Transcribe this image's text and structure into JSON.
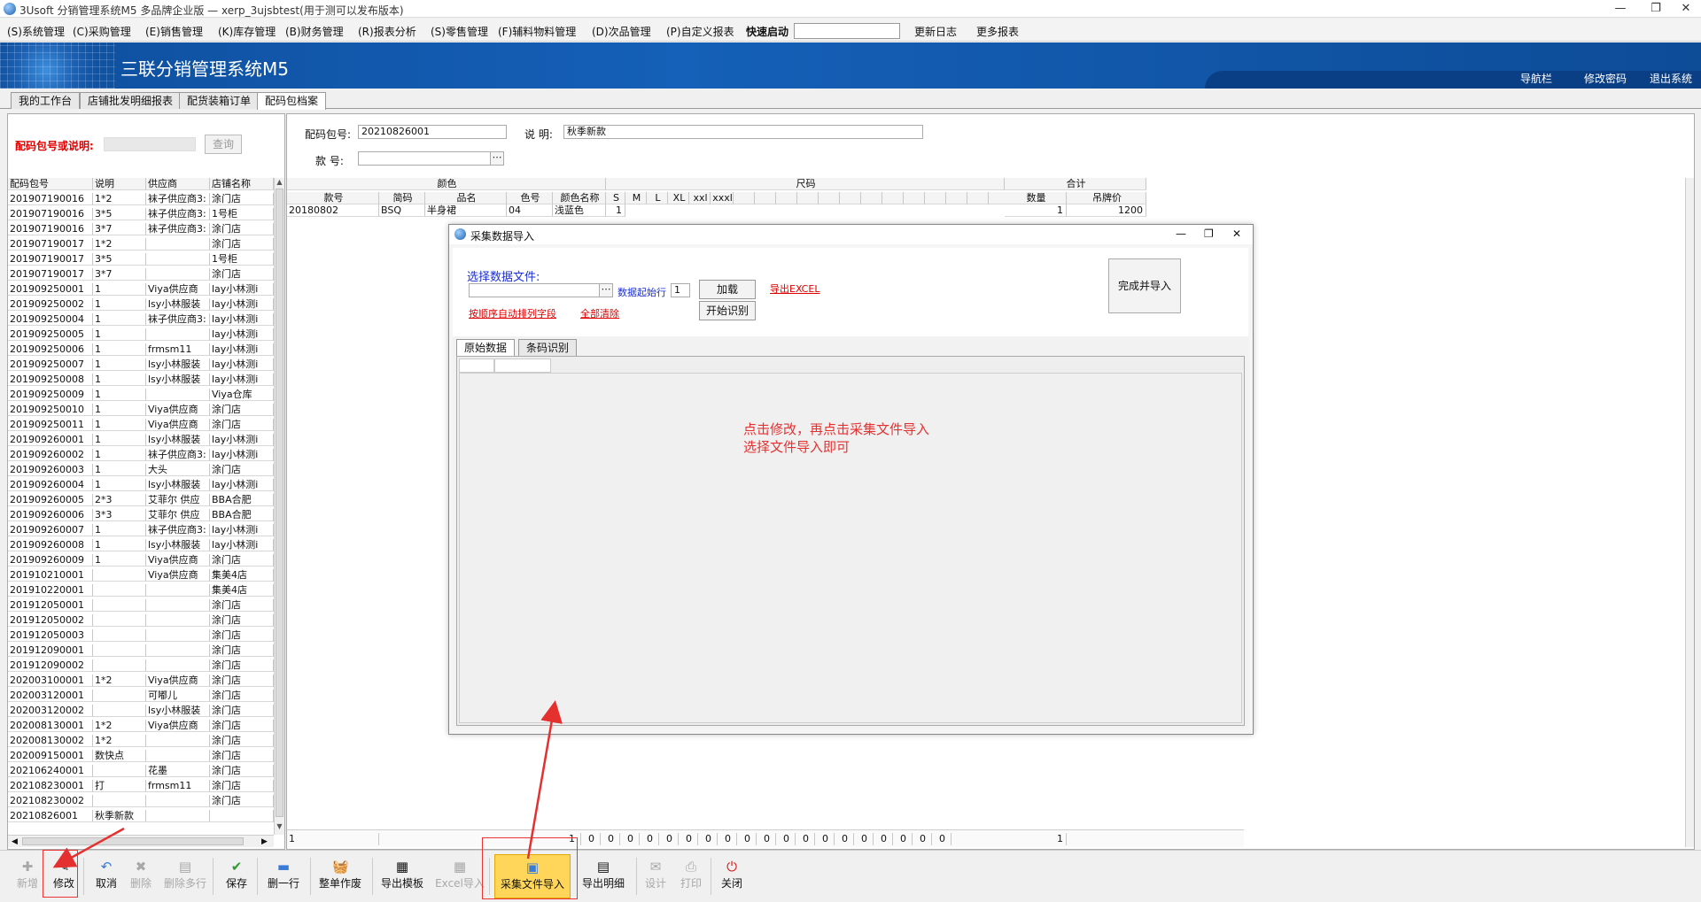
{
  "window": {
    "title": "3Usoft 分销管理系统M5 多品牌企业版 — xerp_3ujsbtest(用于测可以发布版本)"
  },
  "menu": {
    "items": [
      "(S)系统管理",
      "(C)采购管理",
      "(E)销售管理",
      "(K)库存管理",
      "(B)财务管理",
      "(R)报表分析",
      "(S)零售管理",
      "(F)辅料物料管理",
      "(D)次品管理",
      "(P)自定义报表"
    ],
    "quick_launch_label": "快速启动",
    "changelog": "更新日志",
    "more_reports": "更多报表"
  },
  "banner": {
    "system_name": "三联分销管理系统M5",
    "links": [
      "导航栏",
      "修改密码",
      "退出系统"
    ]
  },
  "tabs": [
    "我的工作台",
    "店铺批发明细报表",
    "配货装箱订单",
    "配码包档案"
  ],
  "left": {
    "search_label": "配码包号或说明:",
    "query_button": "查询",
    "columns": [
      "配码包号",
      "说明",
      "供应商",
      "店铺名称"
    ],
    "rows": [
      [
        "201907190016",
        "1*2",
        "袜子供应商3:",
        "涂门店"
      ],
      [
        "201907190016",
        "3*5",
        "袜子供应商3:",
        "1号柜"
      ],
      [
        "201907190016",
        "3*7",
        "袜子供应商3:",
        "涂门店"
      ],
      [
        "201907190017",
        "1*2",
        "",
        "涂门店"
      ],
      [
        "201907190017",
        "3*5",
        "",
        "1号柜"
      ],
      [
        "201907190017",
        "3*7",
        "",
        "涂门店"
      ],
      [
        "201909250001",
        "1",
        "Viya供应商",
        "lay小林测i"
      ],
      [
        "201909250002",
        "1",
        "lsy小林服装",
        "lay小林测i"
      ],
      [
        "201909250004",
        "1",
        "袜子供应商3:",
        "lay小林测i"
      ],
      [
        "201909250005",
        "1",
        "",
        "lay小林测i"
      ],
      [
        "201909250006",
        "1",
        "frmsm11",
        "lay小林测i"
      ],
      [
        "201909250007",
        "1",
        "lsy小林服装",
        "lay小林测i"
      ],
      [
        "201909250008",
        "1",
        "lsy小林服装",
        "lay小林测i"
      ],
      [
        "201909250009",
        "1",
        "",
        "Viya仓库"
      ],
      [
        "201909250010",
        "1",
        "Viya供应商",
        "涂门店"
      ],
      [
        "201909250011",
        "1",
        "Viya供应商",
        "涂门店"
      ],
      [
        "201909260001",
        "1",
        "lsy小林服装",
        "lay小林测i"
      ],
      [
        "201909260002",
        "1",
        "袜子供应商3:",
        "lay小林测i"
      ],
      [
        "201909260003",
        "1",
        "大头",
        "涂门店"
      ],
      [
        "201909260004",
        "1",
        "lsy小林服装",
        "lay小林测i"
      ],
      [
        "201909260005",
        "2*3",
        "艾菲尔 供应",
        "BBA合肥"
      ],
      [
        "201909260006",
        "3*3",
        "艾菲尔 供应",
        "BBA合肥"
      ],
      [
        "201909260007",
        "1",
        "袜子供应商3:",
        "lay小林测i"
      ],
      [
        "201909260008",
        "1",
        "lsy小林服装",
        "lay小林测i"
      ],
      [
        "201909260009",
        "1",
        "Viya供应商",
        "涂门店"
      ],
      [
        "201910210001",
        "",
        "Viya供应商",
        "集美4店"
      ],
      [
        "201910220001",
        "",
        "",
        "集美4店"
      ],
      [
        "201912050001",
        "",
        "",
        "涂门店"
      ],
      [
        "201912050002",
        "",
        "",
        "涂门店"
      ],
      [
        "201912050003",
        "",
        "",
        "涂门店"
      ],
      [
        "201912090001",
        "",
        "",
        "涂门店"
      ],
      [
        "201912090002",
        "",
        "",
        "涂门店"
      ],
      [
        "202003100001",
        "1*2",
        "Viya供应商",
        "涂门店"
      ],
      [
        "202003120001",
        "",
        "可嘟儿",
        "涂门店"
      ],
      [
        "202003120002",
        "",
        "lsy小林服装",
        "涂门店"
      ],
      [
        "202008130001",
        "1*2",
        "Viya供应商",
        "涂门店"
      ],
      [
        "202008130002",
        "1*2",
        "",
        "涂门店"
      ],
      [
        "202009150001",
        "数快点",
        "",
        "涂门店"
      ],
      [
        "202106240001",
        "",
        "花墨",
        "涂门店"
      ],
      [
        "202108230001",
        "打",
        "frmsm11",
        "涂门店"
      ],
      [
        "202108230002",
        "",
        "",
        "涂门店"
      ],
      [
        "20210826001",
        "秋季新款",
        "",
        ""
      ]
    ]
  },
  "form": {
    "pack_no_label": "配码包号:",
    "pack_no_value": "20210826001",
    "desc_label": "说 明:",
    "desc_value": "秋季新款",
    "style_label": "款 号:",
    "style_value": ""
  },
  "grid": {
    "group_color": "颜色",
    "group_size": "尺码",
    "group_total": "合计",
    "cols": [
      "款号",
      "简码",
      "品名",
      "色号",
      "颜色名称"
    ],
    "sizes": [
      "S",
      "M",
      "L",
      "XL",
      "xxl",
      "xxxl"
    ],
    "total_cols": [
      "数量",
      "吊牌价"
    ],
    "row": {
      "style": "20180802",
      "code": "BSQ",
      "name": "半身裙",
      "color_no": "04",
      "color_name": "浅蓝色",
      "s": "1",
      "qty": "1",
      "price": "1200"
    },
    "footer": {
      "first": "1",
      "sizes": [
        "1",
        "0",
        "0",
        "0",
        "0",
        "0",
        "0",
        "0",
        "0",
        "0",
        "0",
        "0",
        "0",
        "0",
        "0",
        "0",
        "0",
        "0",
        "0",
        "0"
      ],
      "qty": "1"
    }
  },
  "dialog": {
    "title": "采集数据导入",
    "choose_label": "选择数据文件:",
    "start_row_label": "数据起始行",
    "start_row_value": "1",
    "load_button": "加载",
    "export_excel": "导出EXCEL",
    "finish_button": "完成并导入",
    "auto_map": "按顺序自动排列字段",
    "clear_all": "全部清除",
    "recognize_button": "开始识别",
    "tabs": [
      "原始数据",
      "条码识别"
    ],
    "hint_line1": "点击修改，再点击采集文件导入",
    "hint_line2": "选择文件导入即可"
  },
  "toolbar": {
    "buttons": [
      {
        "label": "新增",
        "icon": "add-icon",
        "enabled": false
      },
      {
        "label": "修改",
        "icon": "edit-icon",
        "enabled": true
      },
      {
        "label": "取消",
        "icon": "undo-icon",
        "enabled": true
      },
      {
        "label": "删除",
        "icon": "delete-icon",
        "enabled": false
      },
      {
        "label": "删除多行",
        "icon": "delete-rows-icon",
        "enabled": false
      },
      {
        "label": "保存",
        "icon": "checkmark-icon",
        "enabled": true
      },
      {
        "label": "删一行",
        "icon": "minus-icon",
        "enabled": true
      },
      {
        "label": "整单作废",
        "icon": "basket-icon",
        "enabled": true
      },
      {
        "label": "导出模板",
        "icon": "export-template-icon",
        "enabled": true
      },
      {
        "label": "Excel导入",
        "icon": "excel-import-icon",
        "enabled": false
      },
      {
        "label": "采集文件导入",
        "icon": "collect-import-icon",
        "enabled": true
      },
      {
        "label": "导出明细",
        "icon": "save-disk-icon",
        "enabled": true
      },
      {
        "label": "设计",
        "icon": "mail-icon",
        "enabled": false
      },
      {
        "label": "打印",
        "icon": "printer-icon",
        "enabled": false
      },
      {
        "label": "关闭",
        "icon": "power-icon",
        "enabled": true
      }
    ]
  },
  "colors": {
    "accent_red": "#e00000",
    "banner_blue": "#1560b8",
    "link_blue": "#1a2fd6",
    "annotation_red": "#e53030"
  }
}
